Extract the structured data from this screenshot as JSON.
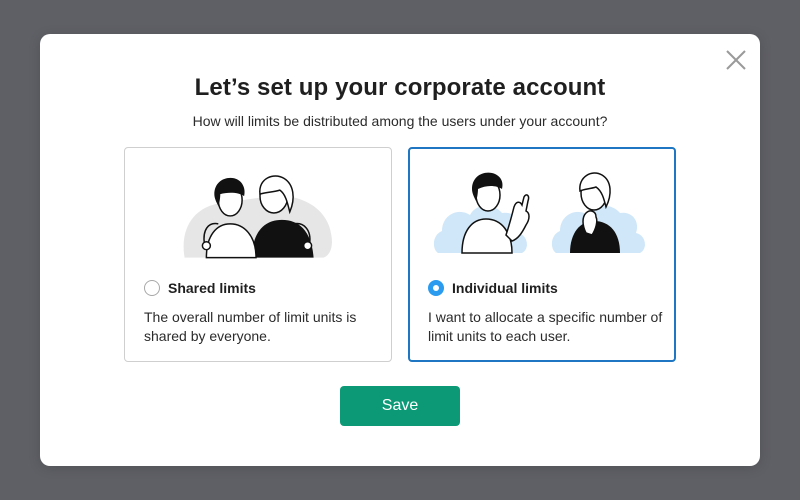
{
  "modal": {
    "title": "Let’s set up your corporate account",
    "subtitle": "How will limits be distributed among the users under your account?",
    "close_icon": "close-icon"
  },
  "options": [
    {
      "label": "Shared limits",
      "description": "The overall number of limit units is shared by everyone.",
      "selected": false,
      "illustration": "two-people-hugging"
    },
    {
      "label": "Individual limits",
      "description": "I want to allocate a specific number of limit units to each user.",
      "selected": true,
      "illustration": "two-people-waving"
    }
  ],
  "actions": {
    "save_label": "Save"
  },
  "colors": {
    "backdrop": "#5f6066",
    "primary_button": "#0c9a76",
    "selected_border": "#1f76c2",
    "radio_selected": "#2a9bef",
    "illustration_blue": "#cfe7f8"
  }
}
